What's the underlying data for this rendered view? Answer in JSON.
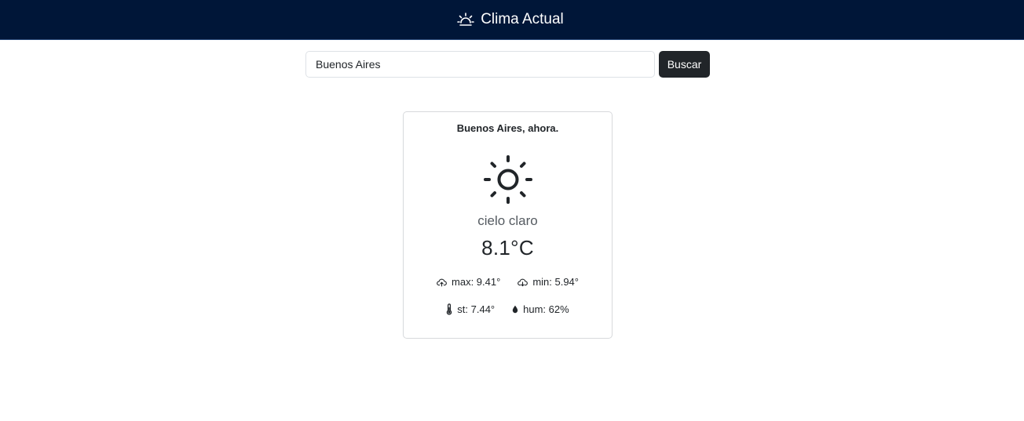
{
  "header": {
    "title": "Clima Actual",
    "icon": "sunrise-icon"
  },
  "search": {
    "value": "Buenos Aires",
    "placeholder": "",
    "button_label": "Buscar"
  },
  "weather": {
    "title": "Buenos Aires, ahora.",
    "icon": "sun-icon",
    "condition": "cielo claro",
    "temperature": "8.1°C",
    "max": "max: 9.41°",
    "min": "min: 5.94°",
    "feels_like": "st: 7.44°",
    "humidity": "hum: 62%"
  },
  "colors": {
    "navbar_bg": "#001638",
    "button_bg": "#212529",
    "text": "#212529"
  }
}
